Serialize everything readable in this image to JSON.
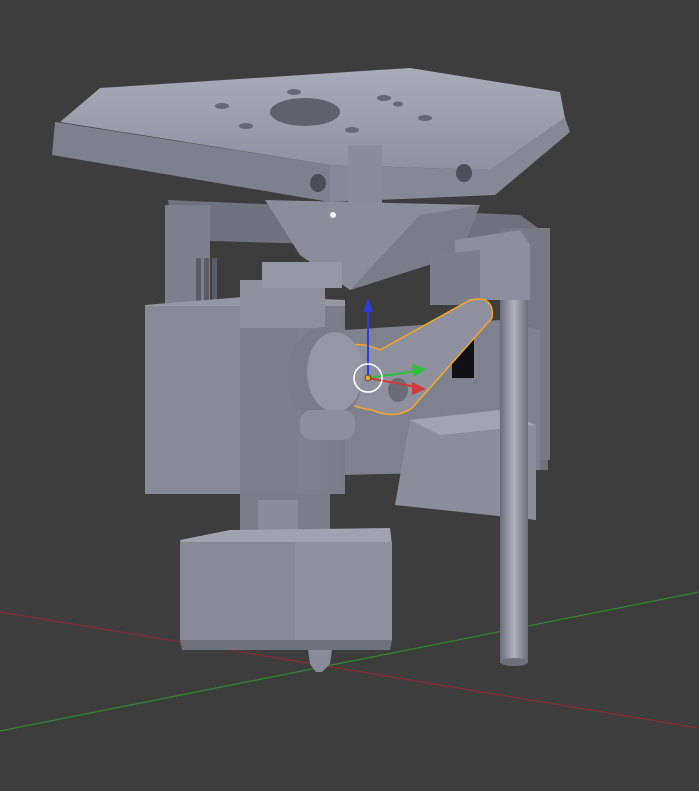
{
  "viewport": {
    "background": "#3d3d3d",
    "model_color": "#8a8c9a",
    "model_light": "#a6a8b6",
    "model_dark": "#5e606c",
    "selection_outline": "#f5a623",
    "axis_x_color": "#d23b3b",
    "axis_y_color": "#2fbf3a",
    "axis_z_color": "#2a3ed6",
    "floor_x_line": "#8a2a2a",
    "floor_y_line": "#2f8a2f"
  }
}
